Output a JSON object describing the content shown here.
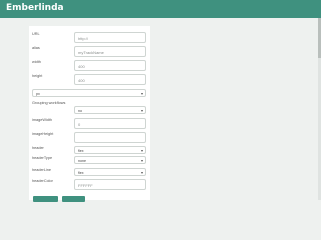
{
  "app": {
    "title": "Emberlinda"
  },
  "fields": [
    {
      "label": "URL",
      "value": "http://"
    },
    {
      "label": "alias",
      "value": "myTrackName"
    },
    {
      "label": "width",
      "value": "400"
    },
    {
      "label": "height",
      "value": "400"
    }
  ],
  "top_select": {
    "value": "px"
  },
  "settings": [
    {
      "label": "Grouping workflows",
      "type": "select",
      "value": "no"
    },
    {
      "label": "imageWidth",
      "type": "input",
      "value": "0"
    },
    {
      "label": "imageHeight",
      "type": "input",
      "value": ""
    },
    {
      "label": "header",
      "type": "select",
      "value": "flex"
    },
    {
      "label": "headerType",
      "type": "select",
      "value": "none"
    },
    {
      "label": "headerLine",
      "type": "select",
      "value": "flex"
    },
    {
      "label": "headerColor",
      "type": "input",
      "value": "FFFFFF"
    }
  ],
  "buttons": {
    "primary_label": "",
    "secondary_label": ""
  },
  "colors": {
    "accent": "#3f917f",
    "background": "#eef1ef"
  }
}
